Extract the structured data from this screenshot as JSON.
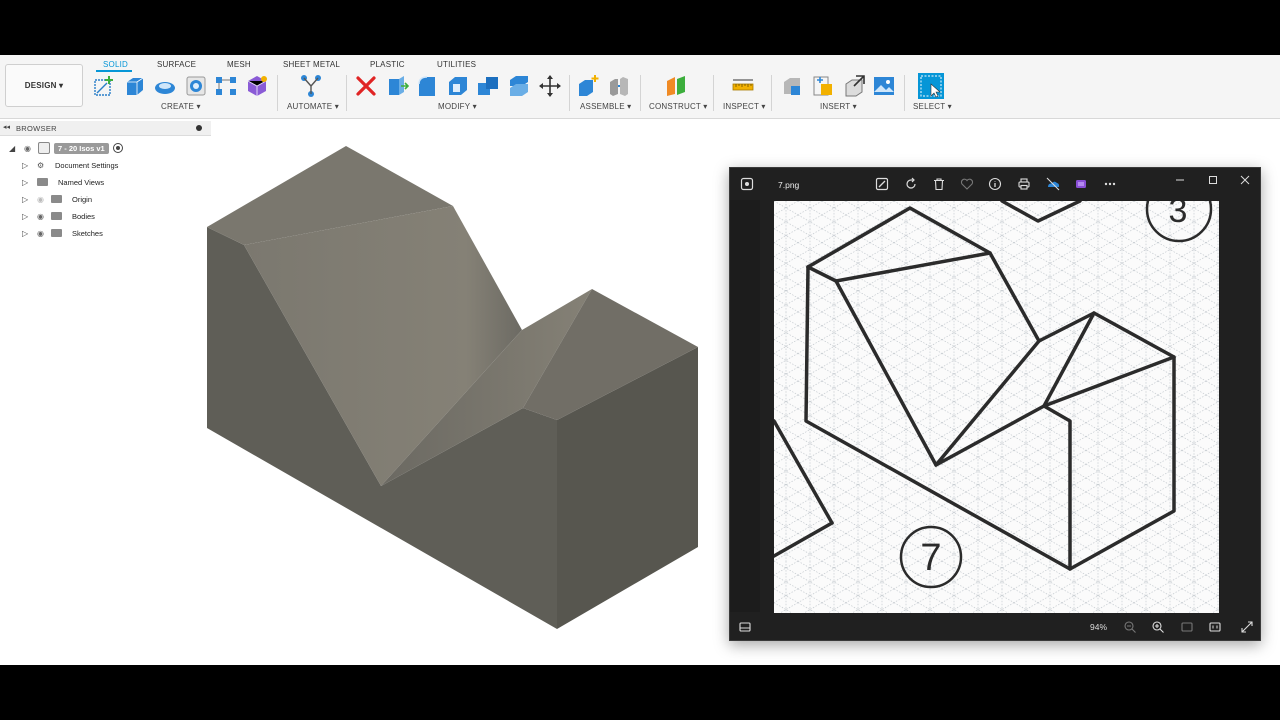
{
  "toolbar": {
    "design_label": "DESIGN ▾",
    "tabs": [
      "SOLID",
      "SURFACE",
      "MESH",
      "SHEET METAL",
      "PLASTIC",
      "UTILITIES"
    ],
    "groups": [
      "CREATE ▾",
      "AUTOMATE ▾",
      "MODIFY ▾",
      "ASSEMBLE ▾",
      "CONSTRUCT ▾",
      "INSPECT ▾",
      "INSERT ▾",
      "SELECT ▾"
    ]
  },
  "browser": {
    "title": "BROWSER",
    "root": "7 - 20 Isos v1",
    "items": [
      "Document Settings",
      "Named Views",
      "Origin",
      "Bodies",
      "Sketches"
    ]
  },
  "photos": {
    "filename": "7.png",
    "zoom": "94%",
    "image_number_label": "7",
    "image_corner_label": "3"
  },
  "colors": {
    "accent": "#0696d7",
    "model_top": "#7a776e",
    "model_front": "#5f5e57",
    "model_side": "#56554f"
  }
}
